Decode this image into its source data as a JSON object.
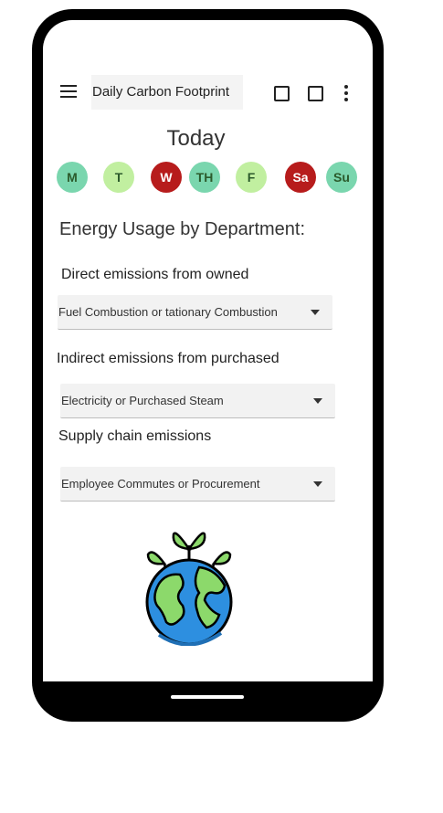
{
  "app": {
    "title": "Daily Carbon Footprint"
  },
  "colors": {
    "green_light": "#c1efa0",
    "teal": "#7ad6ae",
    "red": "#b71c1c"
  },
  "today_label": "Today",
  "days": [
    {
      "label": "M",
      "color": "#7ad6ae"
    },
    {
      "label": "T",
      "color": "#c1efa0"
    },
    {
      "label": "W",
      "color": "#b71c1c"
    },
    {
      "label": "TH",
      "color": "#7ad6ae"
    },
    {
      "label": "F",
      "color": "#c1efa0"
    },
    {
      "label": "Sa",
      "color": "#b71c1c"
    },
    {
      "label": "Su",
      "color": "#7ad6ae"
    }
  ],
  "section": {
    "heading": "Energy Usage by Department:"
  },
  "fields": {
    "direct": {
      "label": "Direct emissions from owned",
      "value": "Fuel Combustion or tationary Combustion"
    },
    "indirect": {
      "label": "Indirect emissions from purchased",
      "value": "Electricity or  Purchased Steam"
    },
    "supply": {
      "label": "Supply chain emissions",
      "value": "Employee Commutes or Procurement"
    }
  },
  "icons": {
    "menu": "menu-icon",
    "square1": "square-icon",
    "square2": "square-icon",
    "more": "more-vert-icon",
    "earth": "earth-plant-icon"
  }
}
